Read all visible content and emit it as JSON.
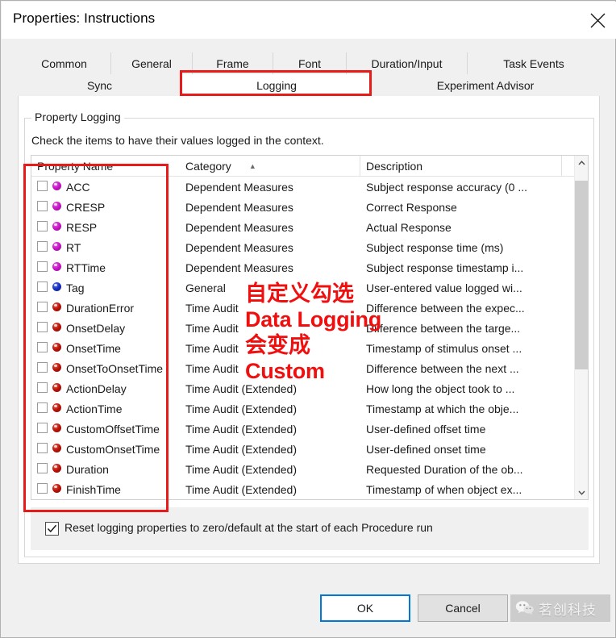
{
  "window": {
    "title": "Properties: Instructions",
    "close_icon": "close-icon"
  },
  "tabs": {
    "row1": [
      {
        "label": "Common",
        "active": false
      },
      {
        "label": "General",
        "active": false
      },
      {
        "label": "Frame",
        "active": false
      },
      {
        "label": "Font",
        "active": false
      },
      {
        "label": "Duration/Input",
        "active": false
      },
      {
        "label": "Task Events",
        "active": false
      }
    ],
    "row2": [
      {
        "label": "Sync",
        "active": false
      },
      {
        "label": "Logging",
        "active": true
      },
      {
        "label": "Experiment Advisor",
        "active": false
      }
    ]
  },
  "group": {
    "legend": "Property Logging",
    "hint": "Check the items to have their values logged in the context."
  },
  "list": {
    "headers": [
      "Property Name",
      "Category",
      "Description"
    ],
    "sort_column": "Category",
    "sort_caret": "▲",
    "rows": [
      {
        "checked": false,
        "icon": "property-bead-magenta",
        "color": "magenta",
        "name": "ACC",
        "category": "Dependent Measures",
        "description": "Subject response accuracy (0 ..."
      },
      {
        "checked": false,
        "icon": "property-bead-magenta",
        "color": "magenta",
        "name": "CRESP",
        "category": "Dependent Measures",
        "description": "Correct Response"
      },
      {
        "checked": false,
        "icon": "property-bead-magenta",
        "color": "magenta",
        "name": "RESP",
        "category": "Dependent Measures",
        "description": "Actual Response"
      },
      {
        "checked": false,
        "icon": "property-bead-magenta",
        "color": "magenta",
        "name": "RT",
        "category": "Dependent Measures",
        "description": "Subject response time (ms)"
      },
      {
        "checked": false,
        "icon": "property-bead-magenta",
        "color": "magenta",
        "name": "RTTime",
        "category": "Dependent Measures",
        "description": "Subject response timestamp i..."
      },
      {
        "checked": false,
        "icon": "property-bead-blue",
        "color": "blue",
        "name": "Tag",
        "category": "General",
        "description": "User-entered value logged wi..."
      },
      {
        "checked": false,
        "icon": "property-bead-red",
        "color": "red",
        "name": "DurationError",
        "category": "Time Audit",
        "description": "Difference between the expec..."
      },
      {
        "checked": false,
        "icon": "property-bead-red",
        "color": "red",
        "name": "OnsetDelay",
        "category": "Time Audit",
        "description": "Difference between the targe..."
      },
      {
        "checked": false,
        "icon": "property-bead-red",
        "color": "red",
        "name": "OnsetTime",
        "category": "Time Audit",
        "description": "Timestamp of stimulus onset ..."
      },
      {
        "checked": false,
        "icon": "property-bead-red",
        "color": "red",
        "name": "OnsetToOnsetTime",
        "category": "Time Audit",
        "description": "Difference between the next ..."
      },
      {
        "checked": false,
        "icon": "property-bead-red",
        "color": "red",
        "name": "ActionDelay",
        "category": "Time Audit (Extended)",
        "description": "How long the object took to ..."
      },
      {
        "checked": false,
        "icon": "property-bead-red",
        "color": "red",
        "name": "ActionTime",
        "category": "Time Audit (Extended)",
        "description": "Timestamp at which the obje..."
      },
      {
        "checked": false,
        "icon": "property-bead-red",
        "color": "red",
        "name": "CustomOffsetTime",
        "category": "Time Audit (Extended)",
        "description": "User-defined offset time"
      },
      {
        "checked": false,
        "icon": "property-bead-red",
        "color": "red",
        "name": "CustomOnsetTime",
        "category": "Time Audit (Extended)",
        "description": "User-defined onset time"
      },
      {
        "checked": false,
        "icon": "property-bead-red",
        "color": "red",
        "name": "Duration",
        "category": "Time Audit (Extended)",
        "description": "Requested Duration of the ob..."
      },
      {
        "checked": false,
        "icon": "property-bead-red",
        "color": "red",
        "name": "FinishTime",
        "category": "Time Audit (Extended)",
        "description": "Timestamp of when object ex..."
      }
    ],
    "scrollbar": {
      "up_arrow": "⌃",
      "down_arrow": "⌄"
    }
  },
  "reset_option": {
    "checked": true,
    "label": "Reset logging properties to zero/default at the start of each Procedure run"
  },
  "footer": {
    "ok_label": "OK",
    "cancel_label": "Cancel"
  },
  "watermark": {
    "text": "茗创科技",
    "icon": "wechat-icon"
  },
  "annotation": {
    "color": "#f00f0f",
    "line1": "自定义勾选",
    "line2": "Data Logging",
    "line3": "会变成",
    "line4": "Custom"
  },
  "colors": {
    "accent": "#0078d7",
    "annotation_red": "#f00f0f",
    "highlight_red": "#e81b1b",
    "dialog_bg": "#f0f0f0"
  }
}
